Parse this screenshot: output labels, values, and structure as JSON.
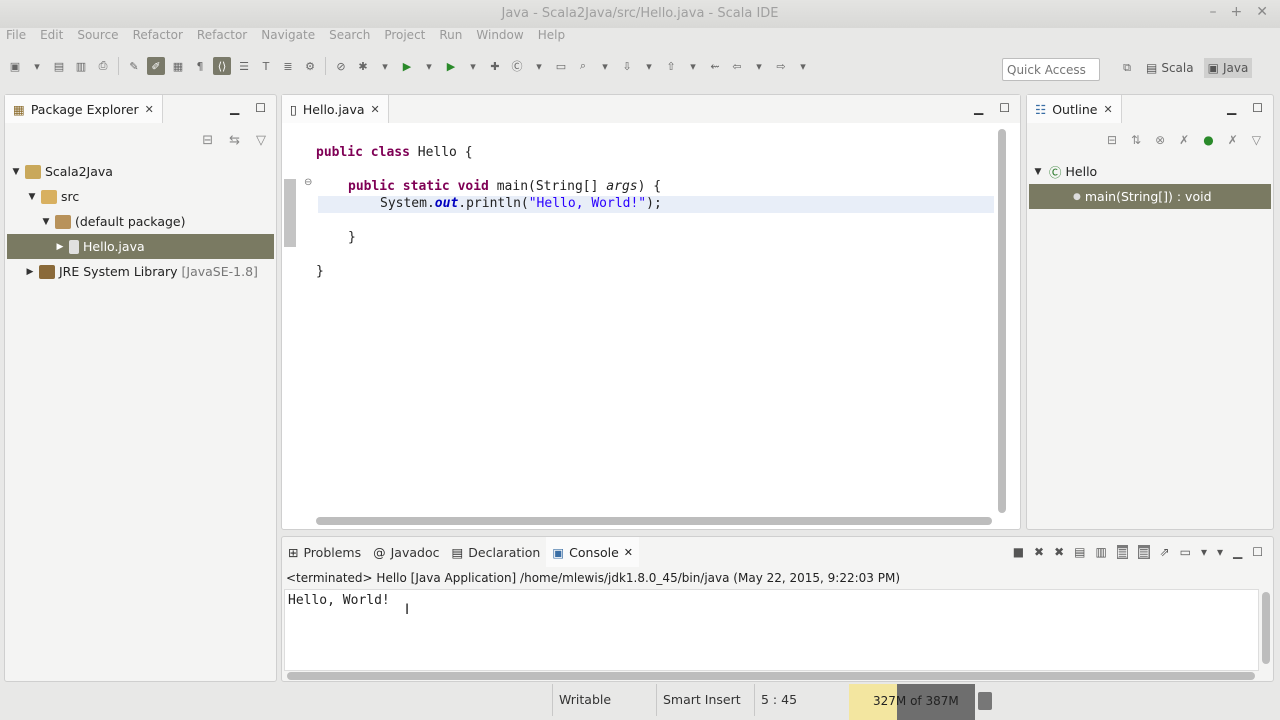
{
  "window": {
    "title": "Java - Scala2Java/src/Hello.java - Scala IDE"
  },
  "menu": [
    "File",
    "Edit",
    "Source",
    "Refactor",
    "Refactor",
    "Navigate",
    "Search",
    "Project",
    "Run",
    "Window",
    "Help"
  ],
  "toolbar": {
    "quick_access_placeholder": "Quick Access",
    "perspectives": [
      "Scala",
      "Java"
    ]
  },
  "package_explorer": {
    "title": "Package Explorer",
    "tree": [
      {
        "label": "Scala2Java",
        "suffix": ""
      },
      {
        "label": "src",
        "suffix": ""
      },
      {
        "label": "(default package)",
        "suffix": ""
      },
      {
        "label": "Hello.java",
        "suffix": ""
      },
      {
        "label": "JRE System Library",
        "suffix": "[JavaSE-1.8]"
      }
    ]
  },
  "editor": {
    "tab": "Hello.java",
    "code": {
      "l1_kw": "public class",
      "l1_rest": " Hello {",
      "l2_kw": "public static void",
      "l2_a": " main(String[] ",
      "l2_param": "args",
      "l2_b": ") {",
      "l3_a": "System.",
      "l3_field": "out",
      "l3_b": ".println(",
      "l3_str": "\"Hello, World!\"",
      "l3_c": ");",
      "l4": "}",
      "l5": "}"
    }
  },
  "outline": {
    "title": "Outline",
    "items": [
      {
        "label": "Hello"
      },
      {
        "label": "main(String[]) : void"
      }
    ]
  },
  "console": {
    "tabs": [
      "Problems",
      "Javadoc",
      "Declaration",
      "Console"
    ],
    "terminated": "<terminated> Hello [Java Application] /home/mlewis/jdk1.8.0_45/bin/java (May 22, 2015, 9:22:03 PM)",
    "output": "Hello, World!"
  },
  "status": {
    "writable": "Writable",
    "insert_mode": "Smart Insert",
    "position": "5 : 45",
    "heap": "327M of 387M"
  }
}
